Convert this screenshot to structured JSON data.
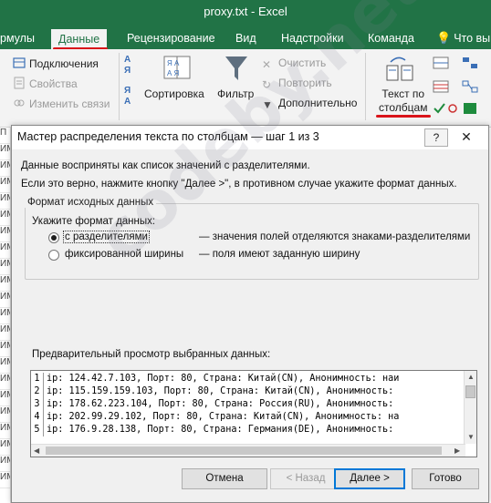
{
  "window": {
    "title": "proxy.txt - Excel"
  },
  "ribbon_tabs": [
    "рмулы",
    "Данные",
    "Рецензирование",
    "Вид",
    "Надстройки",
    "Команда",
    "Что вы"
  ],
  "ribbon": {
    "connections": "Подключения",
    "properties": "Свойства",
    "edit_links": "Изменить связи",
    "sort": "Сортировка",
    "filter": "Фильтр",
    "clear": "Очистить",
    "reapply": "Повторить",
    "advanced": "Дополнительно",
    "text_to_columns_line1": "Текст по",
    "text_to_columns_line2": "столбцам",
    "sort_az": "А Я",
    "sort_ya": "Я А"
  },
  "left_column_cells": [
    "П",
    "ИМ",
    "ИМ",
    "ИМ",
    "ИМ",
    "ИМ",
    "ИМ",
    "ИМ",
    "ИМ",
    "ИМ",
    "ИМ",
    "ИМ",
    "ИМ",
    "ИМ",
    "ИМ",
    "ИМ",
    "ИМ",
    "ИМ",
    "ИМ",
    "ИМ",
    "ИМ",
    "ИМ"
  ],
  "dialog": {
    "title": "Мастер распределения текста по столбцам — шаг 1 из 3",
    "help": "?",
    "close": "✕",
    "line1": "Данные восприняты как список значений с разделителями.",
    "line2": "Если это верно, нажмите кнопку \"Далее >\", в противном случае укажите формат данных.",
    "group_label": "Формат исходных данных",
    "format_prompt": "Укажите формат данных:",
    "option_delimited": "с разделителями",
    "option_delimited_desc": "— значения полей отделяются знаками-разделителями",
    "option_fixed": "фиксированной ширины",
    "option_fixed_desc": "— поля имеют заданную ширину",
    "preview_label": "Предварительный просмотр выбранных данных:",
    "preview_rows": [
      {
        "num": "1",
        "text": "ip: 124.42.7.103, Порт: 80, Страна: Китай(CN), Анонимность: наи"
      },
      {
        "num": "2",
        "text": "ip: 115.159.159.103, Порт: 80, Страна: Китай(CN), Анонимность:"
      },
      {
        "num": "3",
        "text": "ip: 178.62.223.104, Порт: 80, Страна: Россия(RU), Анонимность:"
      },
      {
        "num": "4",
        "text": "ip: 202.99.29.102, Порт: 80, Страна: Китай(CN), Анонимность: на"
      },
      {
        "num": "5",
        "text": "ip: 176.9.28.138, Порт: 80, Страна: Германия(DE), Анонимность:"
      }
    ],
    "buttons": {
      "cancel": "Отмена",
      "back": "< Назад",
      "next": "Далее >",
      "finish": "Готово"
    }
  },
  "watermark": "codeby.net",
  "colors": {
    "excel_green": "#217346",
    "underline_red": "#d9141a",
    "focus_blue": "#0078d7"
  }
}
